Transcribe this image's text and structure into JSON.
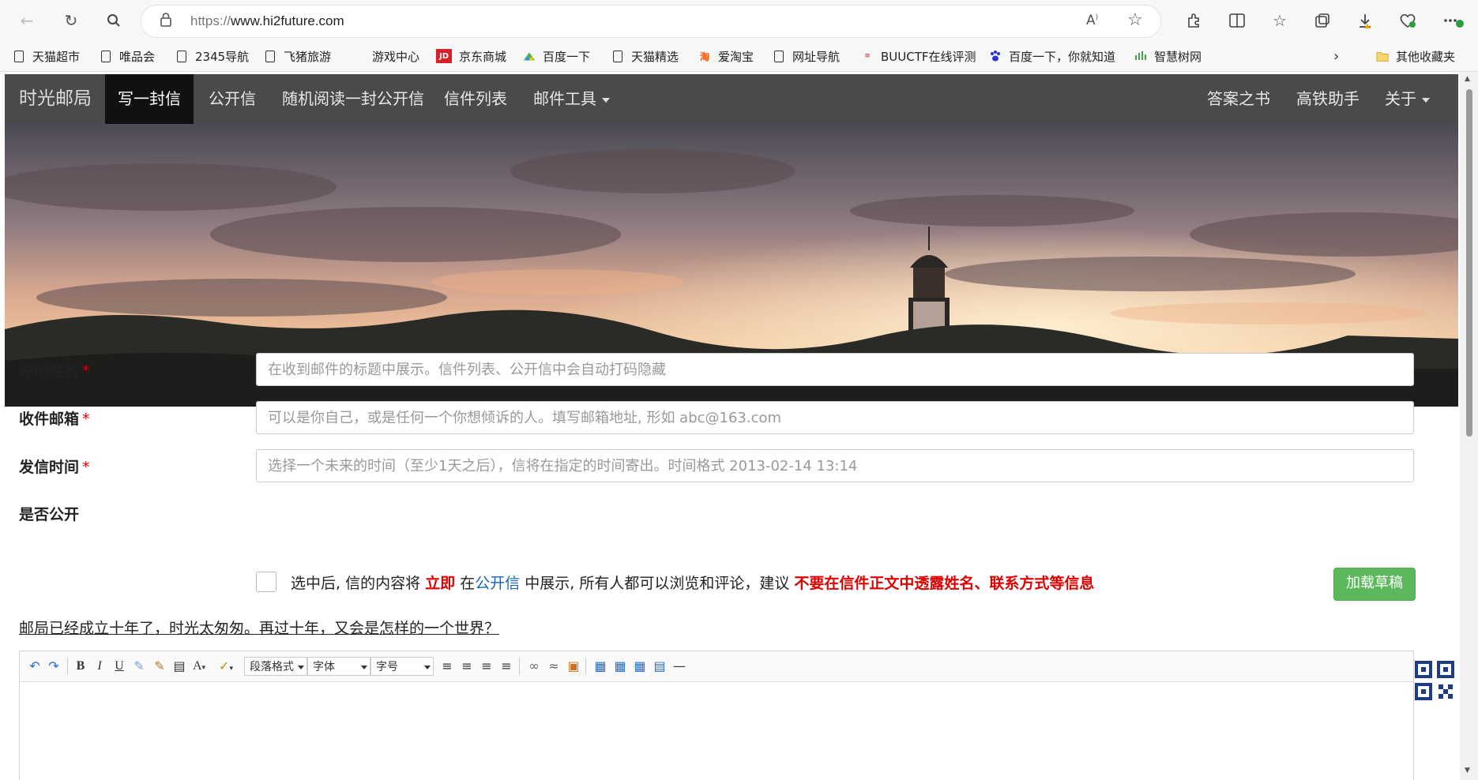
{
  "browser": {
    "url_prefix": "https://",
    "url_host": "www.hi2future.com",
    "bookmarks": [
      "天猫超市",
      "唯品会",
      "2345导航",
      "飞猪旅游",
      "游戏中心",
      "京东商城",
      "百度一下",
      "天猫精选",
      "爱淘宝",
      "网址导航",
      "BUUCTF在线评测",
      "百度一下，你就知道",
      "智慧树网"
    ],
    "other_bookmarks": "其他收藏夹",
    "jd_badge": "JD"
  },
  "nav": {
    "brand": "时光邮局",
    "items": [
      "写一封信",
      "公开信",
      "随机阅读一封公开信",
      "信件列表",
      "邮件工具"
    ],
    "right_items": [
      "答案之书",
      "高铁助手",
      "关于"
    ]
  },
  "form": {
    "name_label": "你的姓名",
    "name_placeholder": "在收到邮件的标题中展示。信件列表、公开信中会自动打码隐藏",
    "email_label": "收件邮箱",
    "email_placeholder": "可以是你自己，或是任何一个你想倾诉的人。填写邮箱地址, 形如 abc@163.com",
    "time_label": "发信时间",
    "time_placeholder": "选择一个未来的时间（至少1天之后），信将在指定的时间寄出。时间格式 2013-02-14 13:14",
    "required_mark": "*",
    "public_label": "是否公开",
    "public_text_1": "选中后, 信的内容将",
    "public_text_now": "立即",
    "public_text_2": "在",
    "public_text_link": "公开信",
    "public_text_3": "中展示, 所有人都可以浏览和评论，建议",
    "public_text_warning": "不要在信件正文中透露姓名、联系方式等信息",
    "draft_button": "加载草稿",
    "motto": "邮局已经成立十年了，时光太匆匆。再过十年，又会是怎样的一个世界？"
  },
  "editor": {
    "paragraph_select": "段落格式",
    "font_select": "字体",
    "size_select": "字号"
  }
}
